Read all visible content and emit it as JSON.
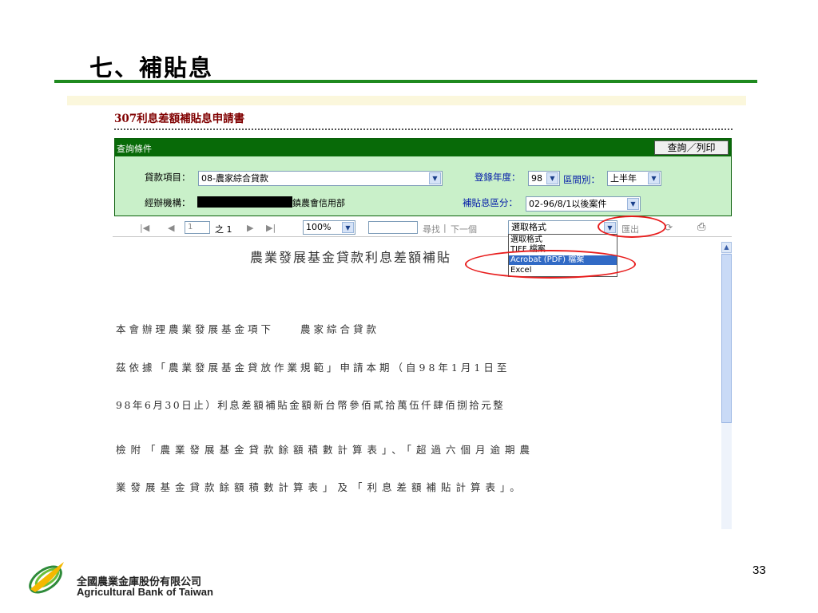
{
  "slide": {
    "title": "七、補貼息",
    "page_number": "33"
  },
  "app": {
    "title": "307利息差額補貼息申請書"
  },
  "query": {
    "header_label": "查詢條件",
    "print_button": "查詢／列印",
    "loan_item_label": "貸款項目：",
    "loan_item_value": "08-農家綜合貸款",
    "register_year_label": "登錄年度：",
    "register_year_value": "98",
    "interval_label": "區間別：",
    "interval_value": "上半年",
    "agency_label": "經辦機構：",
    "agency_value_visible": "鎮農會信用部",
    "subsidy_section_label": "補貼息區分：",
    "subsidy_section_value": "02-96/8/1以後案件"
  },
  "toolbar": {
    "page_input": "1",
    "page_of": "之 1",
    "zoom": "100%",
    "search_link": "尋找",
    "separator": "|",
    "next_link": "下一個",
    "format_select": "選取格式",
    "export_button": "匯出"
  },
  "format_options": [
    {
      "label": "選取格式",
      "selected": false
    },
    {
      "label": "TIFF 檔案",
      "selected": false
    },
    {
      "label": "Acrobat (PDF) 檔案",
      "selected": true
    },
    {
      "label": "Excel",
      "selected": false
    }
  ],
  "report": {
    "title": "農業發展基金貸款利息差額補貼",
    "lines": [
      "本會辦理農業發展基金項下　　農家綜合貸款",
      "茲依據「農業發展基金貸放作業規範」申請本期（自98年1月1日至",
      "98年6月30日止）利息差額補貼金額新台幣參佰貳拾萬伍仟肆佰捌拾元整",
      "檢附「農業發展基金貸款餘額積數計算表」、「超過六個月逾期農",
      "業發展基金貸款餘額積數計算表」及「利息差額補貼計算表」。"
    ]
  },
  "footer": {
    "company_zh": "全國農業金庫股份有限公司",
    "company_en": "Agricultural Bank of Taiwan"
  },
  "colors": {
    "title_rule": "#1f8a1f",
    "panel_header": "#086a08",
    "panel_bg": "#c9f0c9",
    "app_title": "#800000",
    "highlight_ellipse": "#e81c1c",
    "selected_option": "#316ac5"
  }
}
